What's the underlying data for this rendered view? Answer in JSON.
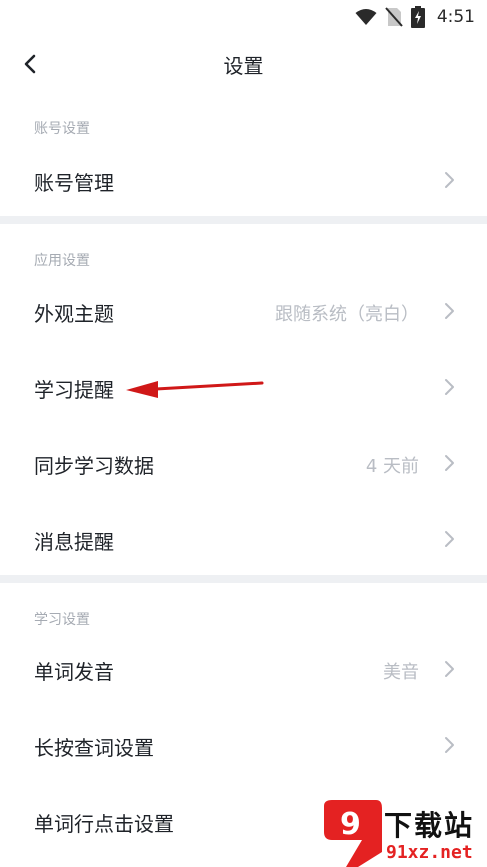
{
  "status_bar": {
    "time": "4:51",
    "icons": [
      "wifi-icon",
      "no-sim-icon",
      "battery-charging-icon"
    ]
  },
  "header": {
    "title": "设置",
    "back_icon": "chevron-left-icon"
  },
  "sections": [
    {
      "label": "账号设置",
      "items": [
        {
          "label": "账号管理",
          "value": ""
        }
      ]
    },
    {
      "label": "应用设置",
      "items": [
        {
          "label": "外观主题",
          "value": "跟随系统（亮白）"
        },
        {
          "label": "学习提醒",
          "value": ""
        },
        {
          "label": "同步学习数据",
          "value": "4 天前"
        },
        {
          "label": "消息提醒",
          "value": ""
        }
      ]
    },
    {
      "label": "学习设置",
      "items": [
        {
          "label": "单词发音",
          "value": "美音"
        },
        {
          "label": "长按查词设置",
          "value": ""
        },
        {
          "label": "单词行点击设置",
          "value": ""
        }
      ]
    }
  ],
  "watermark": {
    "logo_text": "9",
    "title": "下载站",
    "url": "91xz.net"
  },
  "colors": {
    "background": "#ffffff",
    "divider": "#eef0f3",
    "section_label": "#a6abb3",
    "primary_text": "#1f2329",
    "secondary_text": "#b9bdc4",
    "chevron": "#b9bdc4",
    "annotation_arrow": "#d01818",
    "watermark_red": "#e42222"
  }
}
